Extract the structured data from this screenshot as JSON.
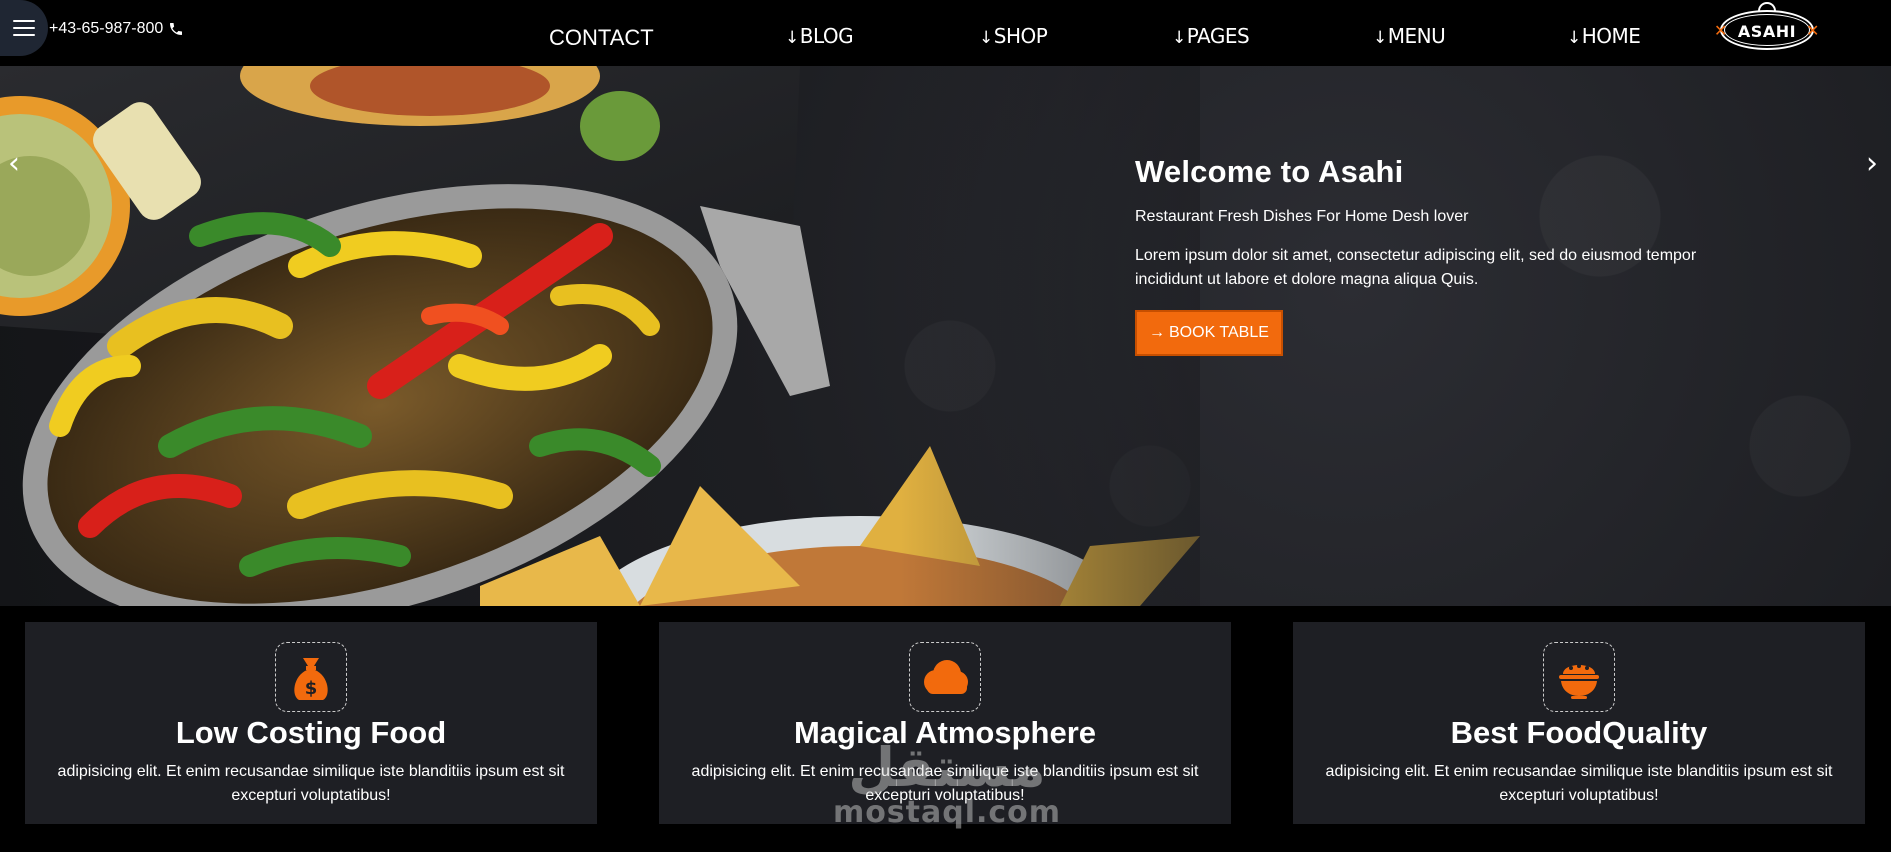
{
  "header": {
    "phone": "+43-65-987-800",
    "nav": [
      {
        "label": "CONTACT",
        "has_arrow": false
      },
      {
        "label": "BLOG",
        "has_arrow": true
      },
      {
        "label": "SHOP",
        "has_arrow": true
      },
      {
        "label": "PAGES",
        "has_arrow": true
      },
      {
        "label": "MENU",
        "has_arrow": true
      },
      {
        "label": "HOME",
        "has_arrow": true
      }
    ],
    "logo_text": "ASAHI"
  },
  "hero": {
    "title": "Welcome to Asahi",
    "subtitle": "Restaurant Fresh Dishes For Home Desh lover",
    "text": "Lorem ipsum dolor sit amet, consectetur adipiscing elit, sed do eiusmod tempor incididunt ut labore et dolore magna aliqua Quis.",
    "button_label": "BOOK TABLE",
    "prev_arrow": "‹",
    "next_arrow": "›"
  },
  "features": [
    {
      "icon": "money-bag-icon",
      "title": "Low Costing Food",
      "desc": "adipisicing elit. Et enim recusandae similique iste blanditiis ipsum est sit excepturi voluptatibus!"
    },
    {
      "icon": "cloud-icon",
      "title": "Magical Atmosphere",
      "desc": "adipisicing elit. Et enim recusandae similique iste blanditiis ipsum est sit excepturi voluptatibus!"
    },
    {
      "icon": "food-bowl-icon",
      "title": "Best FoodQuality",
      "desc": "adipisicing elit. Et enim recusandae similique iste blanditiis ipsum est sit excepturi voluptatibus!"
    }
  ],
  "watermark": {
    "arabic": "مستقل",
    "latin": "mostaql.com"
  },
  "colors": {
    "accent": "#f26a0d",
    "card_bg": "#1e1f24",
    "page_bg": "#000000"
  }
}
